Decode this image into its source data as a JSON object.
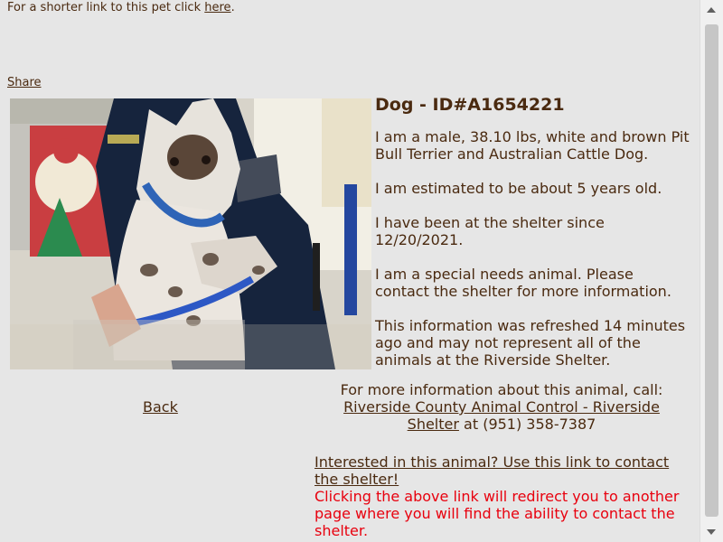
{
  "top": {
    "shorter_link_text": "For a shorter link to this pet click",
    "here_link": "here",
    "period": "."
  },
  "share_link": "Share",
  "pet": {
    "heading": "Dog - ID#A1654221",
    "description": "I am a male, 38.10 lbs, white and brown Pit Bull Terrier and Australian Cattle Dog.",
    "age": "I am estimated to be about 5 years old.",
    "shelter_since": "I have been at the shelter since 12/20/2021.",
    "special_needs": "I am a special needs animal. Please contact the shelter for more information.",
    "refresh_note": "This information was refreshed 14 minutes ago and may not represent all of the animals at the Riverside Shelter."
  },
  "back_link": "Back",
  "more_info": {
    "intro": "For more information about this animal, call:",
    "shelter_link": "Riverside County Animal Control - Riverside Shelter",
    "phone": "at (951) 358-7387"
  },
  "contact": {
    "link": "Interested in this animal? Use this link to contact the shelter!",
    "warning": "Clicking the above link will redirect you to another page where you will find the ability to contact the shelter."
  },
  "colors": {
    "text": "#4a2a10",
    "background": "#e6e6e6",
    "warning": "#e8000e"
  },
  "icons": {
    "scroll_up": "chevron-up-icon",
    "scroll_down": "chevron-down-icon"
  }
}
